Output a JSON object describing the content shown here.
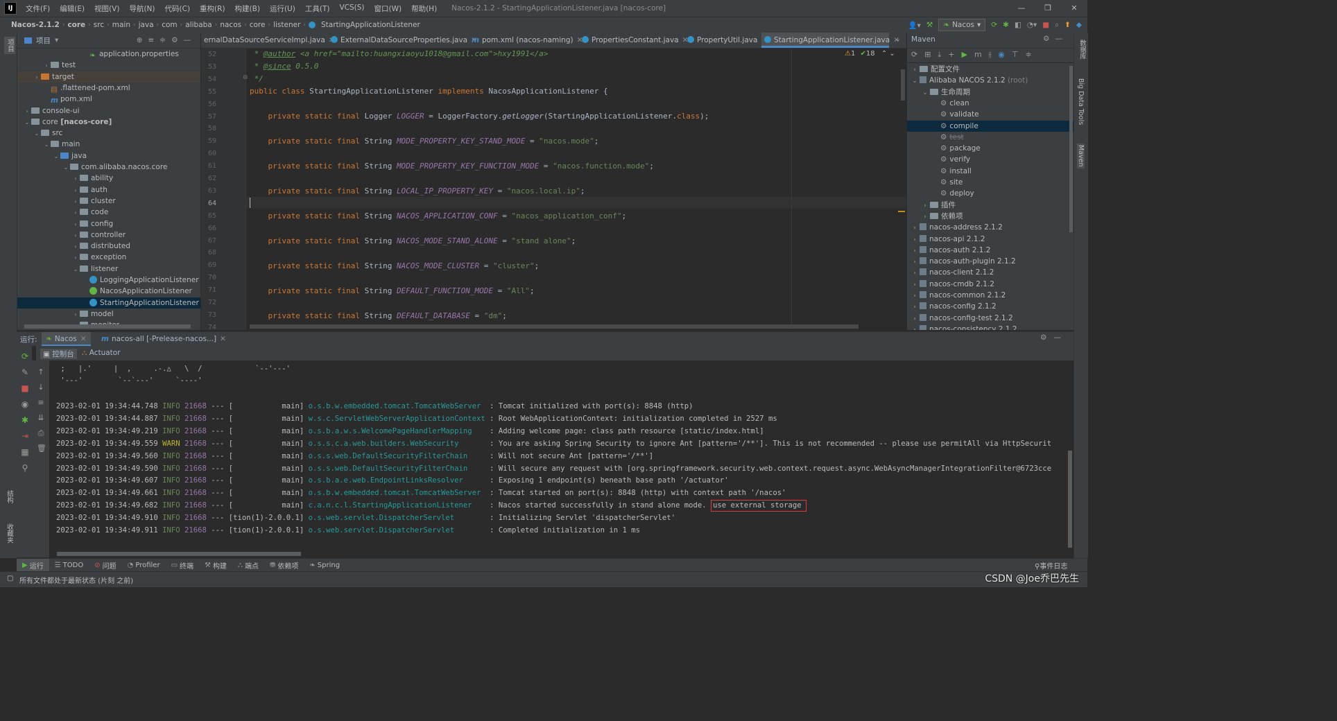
{
  "menu": {
    "items": [
      "文件(F)",
      "编辑(E)",
      "视图(V)",
      "导航(N)",
      "代码(C)",
      "重构(R)",
      "构建(B)",
      "运行(U)",
      "工具(T)",
      "VCS(S)",
      "窗口(W)",
      "帮助(H)"
    ],
    "window_title": "Nacos-2.1.2 - StartingApplicationListener.java [nacos-core]"
  },
  "breadcrumb": [
    "Nacos-2.1.2",
    "core",
    "src",
    "main",
    "java",
    "com",
    "alibaba",
    "nacos",
    "core",
    "listener",
    "StartingApplicationListener"
  ],
  "run_config": "Nacos",
  "project_panel": {
    "title": "项目",
    "rows": [
      {
        "label": "application.properties",
        "depth": 6,
        "kind": "props",
        "arrow": ""
      },
      {
        "label": "test",
        "depth": 2,
        "kind": "folder",
        "arrow": ">"
      },
      {
        "label": "target",
        "depth": 1,
        "kind": "target",
        "arrow": ">"
      },
      {
        "label": ".flattened-pom.xml",
        "depth": 2,
        "kind": "xml",
        "arrow": ""
      },
      {
        "label": "pom.xml",
        "depth": 2,
        "kind": "pom",
        "arrow": ""
      },
      {
        "label": "console-ui",
        "depth": 0,
        "kind": "folder",
        "arrow": ">"
      },
      {
        "label": "core",
        "suffix": " [nacos-core]",
        "depth": 0,
        "kind": "folder",
        "arrow": "v"
      },
      {
        "label": "src",
        "depth": 1,
        "kind": "folder",
        "arrow": "v"
      },
      {
        "label": "main",
        "depth": 2,
        "kind": "folder",
        "arrow": "v"
      },
      {
        "label": "java",
        "depth": 3,
        "kind": "src",
        "arrow": "v"
      },
      {
        "label": "com.alibaba.nacos.core",
        "depth": 4,
        "kind": "folder",
        "arrow": "v"
      },
      {
        "label": "ability",
        "depth": 5,
        "kind": "folder",
        "arrow": ">"
      },
      {
        "label": "auth",
        "depth": 5,
        "kind": "folder",
        "arrow": ">"
      },
      {
        "label": "cluster",
        "depth": 5,
        "kind": "folder",
        "arrow": ">"
      },
      {
        "label": "code",
        "depth": 5,
        "kind": "folder",
        "arrow": ">"
      },
      {
        "label": "config",
        "depth": 5,
        "kind": "folder",
        "arrow": ">"
      },
      {
        "label": "controller",
        "depth": 5,
        "kind": "folder",
        "arrow": ">"
      },
      {
        "label": "distributed",
        "depth": 5,
        "kind": "folder",
        "arrow": ">"
      },
      {
        "label": "exception",
        "depth": 5,
        "kind": "folder",
        "arrow": ">"
      },
      {
        "label": "listener",
        "depth": 5,
        "kind": "folder",
        "arrow": "v"
      },
      {
        "label": "LoggingApplicationListener",
        "depth": 6,
        "kind": "class",
        "arrow": ""
      },
      {
        "label": "NacosApplicationListener",
        "depth": 6,
        "kind": "iface",
        "arrow": ""
      },
      {
        "label": "StartingApplicationListener",
        "depth": 6,
        "kind": "class",
        "arrow": "",
        "selected": true
      },
      {
        "label": "model",
        "depth": 5,
        "kind": "folder",
        "arrow": ">"
      },
      {
        "label": "monitor",
        "depth": 5,
        "kind": "folder",
        "arrow": ">"
      }
    ]
  },
  "editor_tabs": [
    {
      "label": "ernalDataSourceServiceImpl.java",
      "icon": "class"
    },
    {
      "label": "ExternalDataSourceProperties.java",
      "icon": "class"
    },
    {
      "label": "pom.xml (nacos-naming)",
      "icon": "maven"
    },
    {
      "label": "PropertiesConstant.java",
      "icon": "class"
    },
    {
      "label": "PropertyUtil.java",
      "icon": "class"
    },
    {
      "label": "StartingApplicationListener.java",
      "icon": "class",
      "active": true
    }
  ],
  "inspections": {
    "warnings": "1",
    "ok": "18"
  },
  "line_numbers": [
    "52",
    "53",
    "54",
    "55",
    "56",
    "57",
    "58",
    "59",
    "60",
    "61",
    "62",
    "63",
    "64",
    "65",
    "66",
    "67",
    "68",
    "69",
    "70",
    "71",
    "72",
    "73",
    "74"
  ],
  "code": {
    "l52_tag": "@author",
    "l52_rest": " <a href=\"mailto:huangxiaoyu1018@gmail.com\">hxy1991</a>",
    "l53_tag": "@since",
    "l53_rest": " 0.5.0",
    "l54": " */",
    "l55_a": "public class",
    "l55_b": " StartingApplicationListener ",
    "l55_c": "implements",
    "l55_d": " NacosApplicationListener {",
    "l57_type": " Logger ",
    "l57_name": "LOGGER",
    "l57_rest": " = LoggerFactory.",
    "l57_meth": "getLogger",
    "l57_tail": "(StartingApplicationListener.",
    "l57_kw": "class",
    "l57_end": ");",
    "mods": "private static final",
    "str_type": " String ",
    "fields": [
      {
        "name": "MODE_PROPERTY_KEY_STAND_MODE",
        "value": "\"nacos.mode\""
      },
      {
        "name": "MODE_PROPERTY_KEY_FUNCTION_MODE",
        "value": "\"nacos.function.mode\""
      },
      {
        "name": "LOCAL_IP_PROPERTY_KEY",
        "value": "\"nacos.local.ip\""
      },
      {
        "name": "NACOS_APPLICATION_CONF",
        "value": "\"nacos_application_conf\""
      },
      {
        "name": "NACOS_MODE_STAND_ALONE",
        "value": "\"stand alone\""
      },
      {
        "name": "NACOS_MODE_CLUSTER",
        "value": "\"cluster\""
      },
      {
        "name": "DEFAULT_FUNCTION_MODE",
        "value": "\"All\""
      },
      {
        "name": "DEFAULT_DATABASE",
        "value": "\"dm\""
      }
    ]
  },
  "maven": {
    "title": "Maven",
    "rows": [
      {
        "label": "配置文件",
        "depth": 0,
        "arrow": ">",
        "kind": "folder"
      },
      {
        "label": "Alibaba NACOS 2.1.2",
        "suffix": " (root)",
        "depth": 0,
        "arrow": "v",
        "kind": "mvn"
      },
      {
        "label": "生命周期",
        "depth": 1,
        "arrow": "v",
        "kind": "folder"
      },
      {
        "label": "clean",
        "depth": 2,
        "arrow": "",
        "kind": "goal"
      },
      {
        "label": "validate",
        "depth": 2,
        "arrow": "",
        "kind": "goal"
      },
      {
        "label": "compile",
        "depth": 2,
        "arrow": "",
        "kind": "goal",
        "selected": true
      },
      {
        "label": "test",
        "depth": 2,
        "arrow": "",
        "kind": "goal",
        "struck": true
      },
      {
        "label": "package",
        "depth": 2,
        "arrow": "",
        "kind": "goal"
      },
      {
        "label": "verify",
        "depth": 2,
        "arrow": "",
        "kind": "goal"
      },
      {
        "label": "install",
        "depth": 2,
        "arrow": "",
        "kind": "goal"
      },
      {
        "label": "site",
        "depth": 2,
        "arrow": "",
        "kind": "goal"
      },
      {
        "label": "deploy",
        "depth": 2,
        "arrow": "",
        "kind": "goal"
      },
      {
        "label": "插件",
        "depth": 1,
        "arrow": ">",
        "kind": "folder"
      },
      {
        "label": "依赖项",
        "depth": 1,
        "arrow": ">",
        "kind": "folder"
      },
      {
        "label": "nacos-address 2.1.2",
        "depth": 0,
        "arrow": ">",
        "kind": "mvn"
      },
      {
        "label": "nacos-api 2.1.2",
        "depth": 0,
        "arrow": ">",
        "kind": "mvn"
      },
      {
        "label": "nacos-auth 2.1.2",
        "depth": 0,
        "arrow": ">",
        "kind": "mvn"
      },
      {
        "label": "nacos-auth-plugin 2.1.2",
        "depth": 0,
        "arrow": ">",
        "kind": "mvn"
      },
      {
        "label": "nacos-client 2.1.2",
        "depth": 0,
        "arrow": ">",
        "kind": "mvn"
      },
      {
        "label": "nacos-cmdb 2.1.2",
        "depth": 0,
        "arrow": ">",
        "kind": "mvn"
      },
      {
        "label": "nacos-common 2.1.2",
        "depth": 0,
        "arrow": ">",
        "kind": "mvn"
      },
      {
        "label": "nacos-config 2.1.2",
        "depth": 0,
        "arrow": ">",
        "kind": "mvn"
      },
      {
        "label": "nacos-config-test 2.1.2",
        "depth": 0,
        "arrow": ">",
        "kind": "mvn"
      },
      {
        "label": "nacos-consistency 2.1.2",
        "depth": 0,
        "arrow": ">",
        "kind": "mvn"
      }
    ]
  },
  "right_strip": {
    "big_data_tools": "Big Data Tools",
    "maven": "Maven",
    "db": "数据库"
  },
  "left_strip": {
    "project": "项目",
    "structure": "结构",
    "bookmarks": "收藏夹"
  },
  "run_panel": {
    "label": "运行:",
    "tabs": [
      "Nacos",
      "nacos-all [-Prelease-nacos...]"
    ],
    "subtabs": [
      "控制台",
      "Actuator"
    ],
    "banner": [
      " ;   |.'     |  ,     .-.△   \\  /            `--'---'",
      " '---'        `--`---'     `----'"
    ],
    "logs": [
      {
        "ts": "2023-02-01 19:34:44.748",
        "lvl": "INFO",
        "pid": "21668",
        "sep": " --- [",
        "thread": "           main]",
        "logger": "o.s.b.w.embedded.tomcat.TomcatWebServer",
        "msg": "  : Tomcat initialized with port(s): 8848 (http)"
      },
      {
        "ts": "2023-02-01 19:34:44.887",
        "lvl": "INFO",
        "pid": "21668",
        "sep": " --- [",
        "thread": "           main]",
        "logger": "w.s.c.ServletWebServerApplicationContext",
        "msg": " : Root WebApplicationContext: initialization completed in 2527 ms"
      },
      {
        "ts": "2023-02-01 19:34:49.219",
        "lvl": "INFO",
        "pid": "21668",
        "sep": " --- [",
        "thread": "           main]",
        "logger": "o.s.b.a.w.s.WelcomePageHandlerMapping",
        "msg": "    : Adding welcome page: class path resource [static/index.html]"
      },
      {
        "ts": "2023-02-01 19:34:49.559",
        "lvl": "WARN",
        "pid": "21668",
        "sep": " --- [",
        "thread": "           main]",
        "logger": "o.s.s.c.a.web.builders.WebSecurity",
        "msg": "       : You are asking Spring Security to ignore Ant [pattern='/**']. This is not recommended -- please use permitAll via HttpSecurit"
      },
      {
        "ts": "2023-02-01 19:34:49.560",
        "lvl": "INFO",
        "pid": "21668",
        "sep": " --- [",
        "thread": "           main]",
        "logger": "o.s.s.web.DefaultSecurityFilterChain",
        "msg": "     : Will not secure Ant [pattern='/**']"
      },
      {
        "ts": "2023-02-01 19:34:49.590",
        "lvl": "INFO",
        "pid": "21668",
        "sep": " --- [",
        "thread": "           main]",
        "logger": "o.s.s.web.DefaultSecurityFilterChain",
        "msg": "     : Will secure any request with [org.springframework.security.web.context.request.async.WebAsyncManagerIntegrationFilter@6723cce"
      },
      {
        "ts": "2023-02-01 19:34:49.607",
        "lvl": "INFO",
        "pid": "21668",
        "sep": " --- [",
        "thread": "           main]",
        "logger": "o.s.b.a.e.web.EndpointLinksResolver",
        "msg": "      : Exposing 1 endpoint(s) beneath base path '/actuator'"
      },
      {
        "ts": "2023-02-01 19:34:49.661",
        "lvl": "INFO",
        "pid": "21668",
        "sep": " --- [",
        "thread": "           main]",
        "logger": "o.s.b.w.embedded.tomcat.TomcatWebServer",
        "msg": "  : Tomcat started on port(s): 8848 (http) with context path '/nacos'"
      },
      {
        "ts": "2023-02-01 19:34:49.682",
        "lvl": "INFO",
        "pid": "21668",
        "sep": " --- [",
        "thread": "           main]",
        "logger": "c.a.n.c.l.StartingApplicationListener",
        "msg": "    : Nacos started successfully in stand alone mode. ",
        "highlight": "use external storage"
      },
      {
        "ts": "2023-02-01 19:34:49.910",
        "lvl": "INFO",
        "pid": "21668",
        "sep": " --- [",
        "thread": "tion(1)-2.0.0.1]",
        "logger": "o.s.web.servlet.DispatcherServlet",
        "msg": "        : Initializing Servlet 'dispatcherServlet'"
      },
      {
        "ts": "2023-02-01 19:34:49.911",
        "lvl": "INFO",
        "pid": "21668",
        "sep": " --- [",
        "thread": "tion(1)-2.0.0.1]",
        "logger": "o.s.web.servlet.DispatcherServlet",
        "msg": "        : Completed initialization in 1 ms"
      }
    ]
  },
  "bottom_tools": [
    "运行",
    "TODO",
    "问题",
    "Profiler",
    "终端",
    "构建",
    "端点",
    "依赖项",
    "Spring"
  ],
  "event_log": "事件日志",
  "status_text": "所有文件都处于最新状态 (片刻 之前)",
  "watermark": "CSDN @Joe乔巴先生",
  "colors": {
    "accent": "#4a88c7",
    "selection": "#0d293e",
    "highlight_box": "#e03b3b"
  }
}
